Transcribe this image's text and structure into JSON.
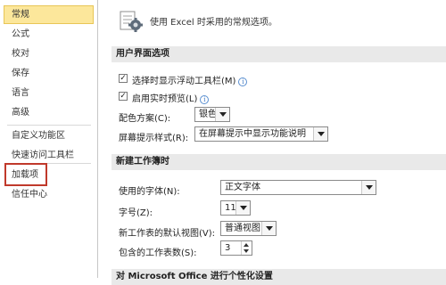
{
  "sidebar": {
    "items": [
      {
        "label": "常规"
      },
      {
        "label": "公式"
      },
      {
        "label": "校对"
      },
      {
        "label": "保存"
      },
      {
        "label": "语言"
      },
      {
        "label": "高级"
      },
      {
        "label": "自定义功能区"
      },
      {
        "label": "快速访问工具栏"
      },
      {
        "label": "加载项"
      },
      {
        "label": "信任中心"
      }
    ],
    "selected_index": 0,
    "highlight_color": "#c0392b"
  },
  "header": {
    "text": "使用 Excel 时采用的常规选项。",
    "icon": "options-general-icon"
  },
  "ui_options": {
    "section_title": "用户界面选项",
    "mini_toolbar": {
      "label": "选择时显示浮动工具栏(M)",
      "checked": true
    },
    "live_preview": {
      "label": "启用实时预览(L)",
      "checked": true
    },
    "color_scheme": {
      "label": "配色方案(C):",
      "value": "银色"
    },
    "screentip_style": {
      "label": "屏幕提示样式(R):",
      "value": "在屏幕提示中显示功能说明"
    }
  },
  "new_workbook": {
    "section_title": "新建工作簿时",
    "font": {
      "label": "使用的字体(N):",
      "value": "正文字体"
    },
    "font_size": {
      "label": "字号(Z):",
      "value": "11"
    },
    "default_view": {
      "label": "新工作表的默认视图(V):",
      "value": "普通视图"
    },
    "sheet_count": {
      "label": "包含的工作表数(S):",
      "value": "3"
    }
  },
  "personalize": {
    "section_title": "对 Microsoft Office 进行个性化设置"
  },
  "colors": {
    "selected_bg": "#fce79b",
    "section_bg": "#e9e9e9",
    "info_icon": "#3b76c4"
  }
}
